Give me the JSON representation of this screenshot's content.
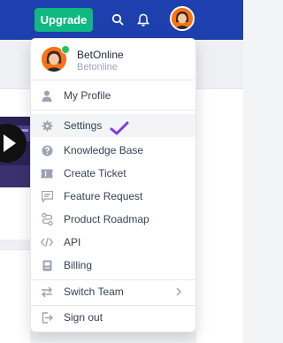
{
  "topbar": {
    "upgrade_label": "Upgrade",
    "icons": [
      "search-icon",
      "bell-icon"
    ]
  },
  "user": {
    "name": "BetOnline",
    "team": "Betonline",
    "online": true
  },
  "menu": {
    "items": [
      {
        "label": "My Profile",
        "icon": "person-icon"
      },
      {
        "label": "Settings",
        "icon": "gear-icon",
        "active": true
      },
      {
        "label": "Knowledge Base",
        "icon": "question-icon"
      },
      {
        "label": "Create Ticket",
        "icon": "ticket-icon"
      },
      {
        "label": "Feature Request",
        "icon": "message-icon"
      },
      {
        "label": "Product Roadmap",
        "icon": "route-icon"
      },
      {
        "label": "API",
        "icon": "code-icon"
      },
      {
        "label": "Billing",
        "icon": "billing-icon"
      },
      {
        "label": "Switch Team",
        "icon": "switch-icon"
      },
      {
        "label": "Sign out",
        "icon": "sign-out-icon"
      }
    ]
  },
  "colors": {
    "topbar": "#1e40af",
    "upgrade": "#10b981",
    "online": "#22c55e",
    "check": "#7c3aed"
  }
}
